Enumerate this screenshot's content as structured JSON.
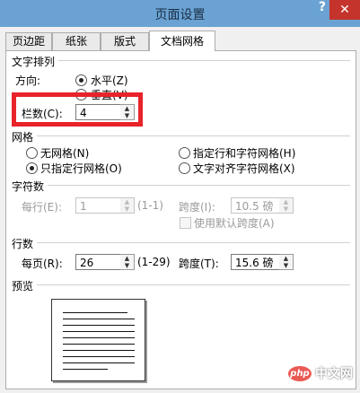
{
  "window": {
    "title": "页面设置",
    "help": "?",
    "close": "✕"
  },
  "tabs": [
    {
      "label": "页边距"
    },
    {
      "label": "纸张"
    },
    {
      "label": "版式"
    },
    {
      "label": "文档网格"
    }
  ],
  "text_direction": {
    "section_label": "文字排列",
    "direction_label": "方向:",
    "options": [
      {
        "label": "水平(Z)",
        "selected": true
      },
      {
        "label": "垂直(V)",
        "selected": false
      }
    ],
    "columns_label": "栏数(C):",
    "columns_value": "4"
  },
  "grid": {
    "section_label": "网格",
    "options": [
      {
        "label": "无网格(N)",
        "selected": false
      },
      {
        "label": "指定行和字符网格(H)",
        "selected": false
      },
      {
        "label": "只指定行网格(O)",
        "selected": true
      },
      {
        "label": "文字对齐字符网格(X)",
        "selected": false
      }
    ]
  },
  "chars": {
    "section_label": "字符数",
    "per_line_label": "每行(E):",
    "per_line_value": "1",
    "per_line_range": "(1-1)",
    "pitch_label": "跨度(I):",
    "pitch_value": "10.5 磅",
    "default_pitch_label": "使用默认跨度(A)"
  },
  "lines": {
    "section_label": "行数",
    "per_page_label": "每页(R):",
    "per_page_value": "26",
    "per_page_range": "(1-29)",
    "pitch_label": "跨度(T):",
    "pitch_value": "15.6 磅"
  },
  "preview": {
    "section_label": "预览"
  },
  "watermark": {
    "logo": "php",
    "text": "中文网"
  },
  "colors": {
    "title_bar": "#6aa3d3",
    "close": "#c4342c",
    "highlight": "#e8232a"
  }
}
